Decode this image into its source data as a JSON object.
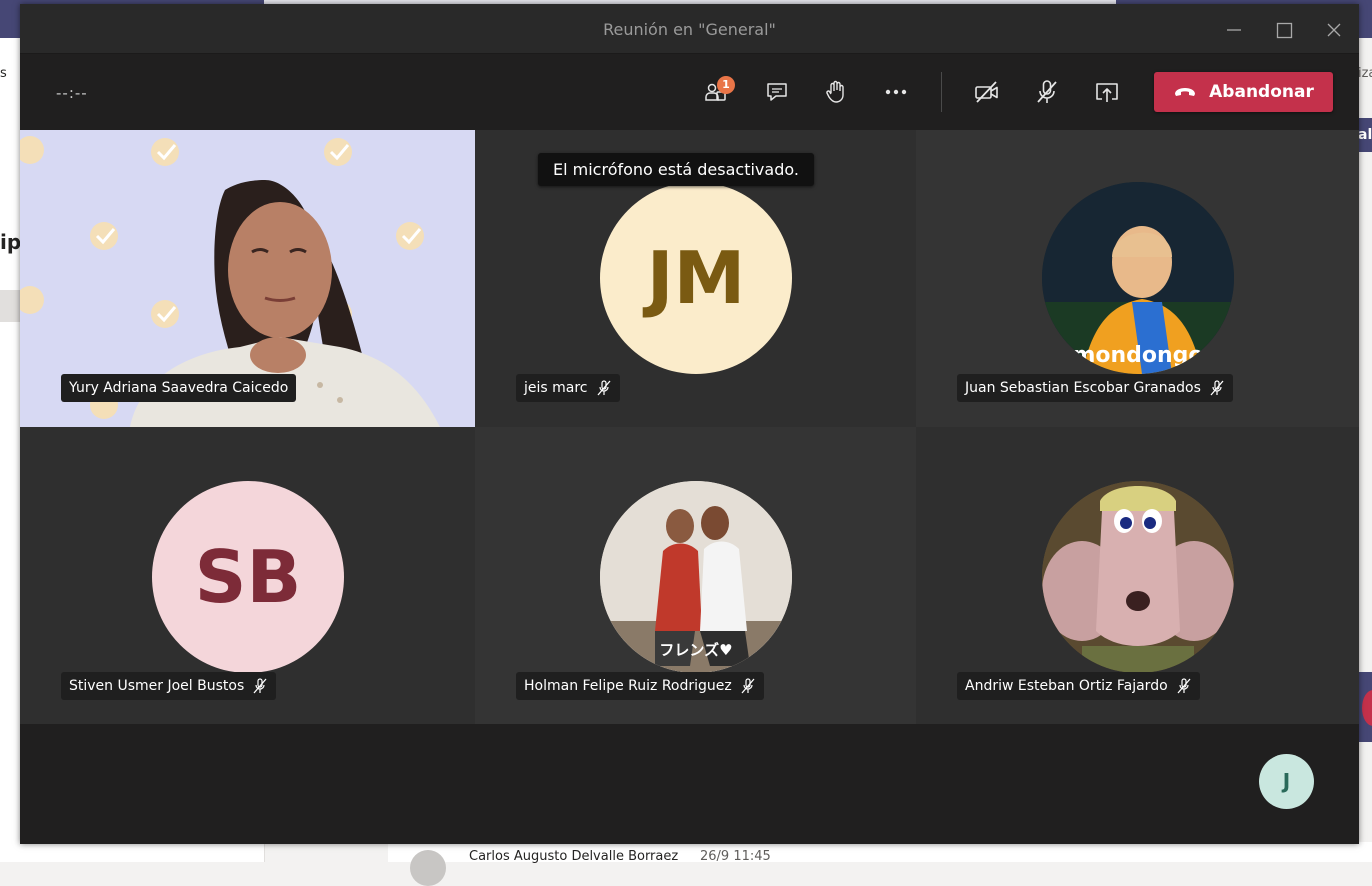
{
  "background": {
    "left_text_fragment": "s",
    "left_heading_fragment": "ipo",
    "right_text_fragment": "iza",
    "right_pill_fragment": "al",
    "chat_author": "Carlos Augusto Delvalle Borraez",
    "chat_time": "26/9 11:45"
  },
  "window": {
    "title": "Reunión en \"General\""
  },
  "toolbar": {
    "timer": "--:--",
    "participants_badge": "1",
    "participants_icon": "people-icon",
    "chat_icon": "chat-icon",
    "raise_hand_icon": "hand-icon",
    "more_icon": "more-icon",
    "camera_icon": "camera-off-icon",
    "mic_icon": "mic-off-icon",
    "share_icon": "share-screen-icon",
    "leave_label": "Abandonar"
  },
  "tooltip": {
    "text": "El micrófono está desactivado."
  },
  "participants": [
    {
      "name": "Yury Adriana Saavedra Caicedo",
      "video": true,
      "muted": false
    },
    {
      "name": "jeis marc",
      "initials": "JM",
      "muted": true
    },
    {
      "name": "Juan Sebastian Escobar Granados",
      "picture": true,
      "picture_caption": "mondongo",
      "muted": true
    },
    {
      "name": "Stiven Usmer Joel Bustos",
      "initials": "SB",
      "muted": true
    },
    {
      "name": "Holman Felipe Ruiz Rodriguez",
      "picture": true,
      "picture_caption": "フレンズ♥",
      "muted": true
    },
    {
      "name": "Andriw Esteban Ortiz Fajardo",
      "picture": true,
      "muted": true
    }
  ],
  "self": {
    "initial": "J"
  },
  "colors": {
    "leave": "#c4314b",
    "badge": "#e97548",
    "jm_bg": "#fbeccb",
    "jm_fg": "#7a5a12",
    "sb_bg": "#f4d6da",
    "sb_fg": "#7d2b38",
    "self_bg": "#c9e7df"
  }
}
